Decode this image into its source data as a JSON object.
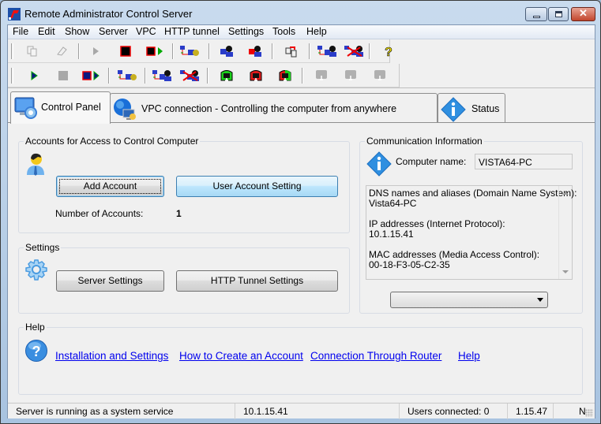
{
  "window": {
    "title": "Remote Administrator Control Server",
    "controls": {
      "minimize": "minimize",
      "maximize": "maximize",
      "close": "✕"
    }
  },
  "menu": [
    "File",
    "Edit",
    "Show",
    "Server",
    "VPC",
    "HTTP tunnel",
    "Settings",
    "Tools",
    "Help"
  ],
  "toolbar1": {
    "buttons": [
      {
        "icon": "copy-icon",
        "enabled": false
      },
      {
        "icon": "eraser-icon",
        "enabled": false
      },
      {
        "icon": "play-icon",
        "enabled": false
      },
      {
        "icon": "stop-icon",
        "enabled": true
      },
      {
        "icon": "stop-play-icon",
        "enabled": true
      },
      {
        "icon": "network-settings-icon",
        "enabled": true
      },
      {
        "icon": "user-blue-icon",
        "enabled": true
      },
      {
        "icon": "user-red-icon",
        "enabled": true
      },
      {
        "icon": "export-icon",
        "enabled": true
      },
      {
        "icon": "connect-user-icon",
        "enabled": true
      },
      {
        "icon": "disconnect-user-icon",
        "enabled": true
      },
      {
        "icon": "help-question-icon",
        "enabled": true
      }
    ]
  },
  "toolbar2": {
    "buttons": [
      {
        "icon": "play-icon",
        "enabled": true
      },
      {
        "icon": "stop-icon",
        "enabled": false
      },
      {
        "icon": "stop-play-icon",
        "enabled": true
      },
      {
        "icon": "network-settings-icon",
        "enabled": true
      },
      {
        "icon": "connect-user-icon",
        "enabled": true
      },
      {
        "icon": "disconnect-user-icon",
        "enabled": true
      },
      {
        "icon": "green-monitor-icon",
        "enabled": true
      },
      {
        "icon": "red-monitor-icon",
        "enabled": true
      },
      {
        "icon": "red-green-monitor-icon",
        "enabled": true
      },
      {
        "icon": "monitor-disabled-icon",
        "enabled": false
      },
      {
        "icon": "monitor-disabled-icon",
        "enabled": false
      },
      {
        "icon": "monitor-disabled-icon",
        "enabled": false
      }
    ]
  },
  "tabs": [
    {
      "label": "Control Panel",
      "active": true
    },
    {
      "label": "VPC connection - Controlling the computer from anywhere",
      "active": false
    },
    {
      "label": "Status",
      "active": false
    }
  ],
  "accounts": {
    "title": "Accounts for Access to Control Computer",
    "add_button": "Add Account",
    "settings_button": "User Account Setting",
    "count_label": "Number of Accounts:",
    "count_value": "1"
  },
  "settings": {
    "title": "Settings",
    "server_button": "Server Settings",
    "tunnel_button": "HTTP Tunnel Settings"
  },
  "communication": {
    "title": "Communication Information",
    "computer_name_label": "Computer name:",
    "computer_name_value": "VISTA64-PC",
    "details": "DNS names and aliases (Domain Name System):\nVista64-PC\n\nIP addresses (Internet Protocol):\n10.1.15.41\n\nMAC addresses (Media Access Control):\n00-18-F3-05-C2-35",
    "combo_value": ""
  },
  "help": {
    "title": "Help",
    "links": [
      "Installation and Settings",
      "How to Create an Account",
      "Connection Through Router",
      "Help"
    ]
  },
  "status": {
    "service": "Server is running as a system service",
    "ip": "10.1.15.41",
    "users": "Users connected: 0",
    "version": "1.15.47",
    "last": "N"
  },
  "colors": {
    "link": "#0000ee",
    "accent": "#3c7fb1"
  }
}
